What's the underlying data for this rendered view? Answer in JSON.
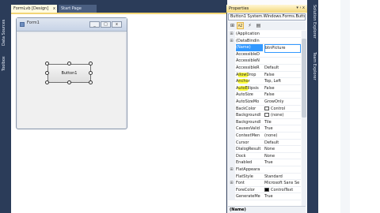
{
  "left_strip": {
    "tabs": [
      "Data Sources",
      "Toolbox"
    ]
  },
  "designer": {
    "tabs": [
      {
        "label": "FormLvb [Design]",
        "close": "x"
      },
      {
        "label": "Start Page"
      }
    ],
    "form": {
      "title": "Form1",
      "caption_buttons": [
        "_",
        "□",
        "x"
      ],
      "button_label": "Button1"
    }
  },
  "properties": {
    "title": "Properties",
    "header_icons": "▾ ‹ x",
    "object_combo": "Button1 System.Windows.Forms.Button",
    "toolbar": [
      "⊞",
      "AZ",
      "⚡",
      "▤"
    ],
    "rows": [
      {
        "expander": "⊞",
        "name": "(Application",
        "value": ""
      },
      {
        "expander": "⊞",
        "name": "(DataBindin",
        "value": ""
      },
      {
        "expander": "",
        "name": "(Name)",
        "value": "btnPicture",
        "selected": true
      },
      {
        "expander": "",
        "name": "AccessibleD",
        "value": ""
      },
      {
        "expander": "",
        "name": "AccessibleN",
        "value": ""
      },
      {
        "expander": "",
        "name": "AccessibleR",
        "value": "Default"
      },
      {
        "expander": "",
        "name": "AllowDrop",
        "value": "False",
        "highlight": true
      },
      {
        "expander": "",
        "name": "Anchor",
        "value": "Top, Left",
        "highlight": true
      },
      {
        "expander": "",
        "name": "AutoEllipsis",
        "value": "False",
        "highlight": true
      },
      {
        "expander": "",
        "name": "AutoSize",
        "value": "False"
      },
      {
        "expander": "",
        "name": "AutoSizeMo",
        "value": "GrowOnly"
      },
      {
        "expander": "",
        "name": "BackColor",
        "value": "Control",
        "swatch": "#f0f0f0"
      },
      {
        "expander": "",
        "name": "BackgroundI",
        "value": "(none)",
        "swatch": "#ffffff"
      },
      {
        "expander": "",
        "name": "BackgroundI",
        "value": "Tile"
      },
      {
        "expander": "",
        "name": "CausesValid",
        "value": "True"
      },
      {
        "expander": "",
        "name": "ContextMen",
        "value": "(none)"
      },
      {
        "expander": "",
        "name": "Cursor",
        "value": "Default"
      },
      {
        "expander": "",
        "name": "DialogResult",
        "value": "None"
      },
      {
        "expander": "",
        "name": "Dock",
        "value": "None"
      },
      {
        "expander": "",
        "name": "Enabled",
        "value": "True"
      },
      {
        "expander": "⊞",
        "name": "FlatAppeara",
        "value": ""
      },
      {
        "expander": "",
        "name": "FlatStyle",
        "value": "Standard"
      },
      {
        "expander": "⊞",
        "name": "Font",
        "value": "Microsoft Sans Se"
      },
      {
        "expander": "",
        "name": "ForeColor",
        "value": "ControlText",
        "swatch": "#000000"
      },
      {
        "expander": "",
        "name": "GenerateMe",
        "value": "True"
      }
    ],
    "description_title": "(Name)"
  },
  "right_strip": {
    "tabs": [
      "Solution Explorer",
      "Team Explorer"
    ]
  },
  "colors": {
    "ide_dark": "#2b3c59",
    "tab_active": "#f2d676",
    "selection": "#3399ff",
    "highlight": "#ffff00"
  }
}
